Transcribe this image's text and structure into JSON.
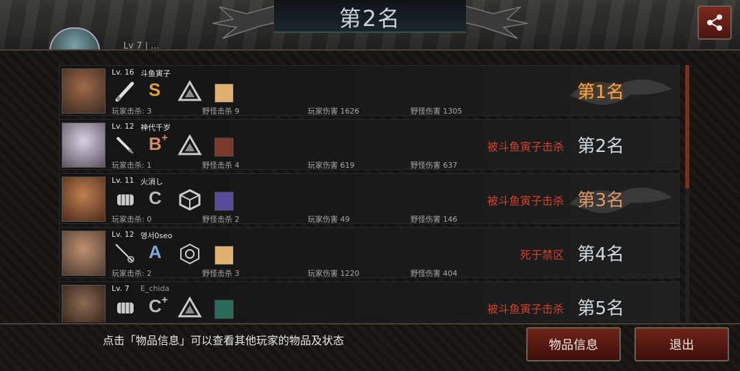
{
  "header": {
    "title": "第2名",
    "partial_label": "Lv 7 | ..."
  },
  "players": [
    {
      "level": "Lv. 16",
      "name": "斗鱼寅子",
      "weapon": "bat-icon",
      "grade": "S",
      "grade_plus": "",
      "grade_color": "#e0a040",
      "trait": "triangle-trait-icon",
      "player_kills": "玩家击杀: 3",
      "monster_kills": "野怪击杀 9",
      "player_damage": "玩家伤害 1626",
      "monster_damage": "野怪伤害 1305",
      "death": "",
      "rank": "第1名"
    },
    {
      "level": "Lv. 12",
      "name": "神代千岁",
      "weapon": "dagger-icon",
      "grade": "B",
      "grade_plus": "+",
      "grade_color": "#d48a6a",
      "trait": "triangle-trait-icon",
      "player_kills": "玩家击杀: 1",
      "monster_kills": "野怪击杀 4",
      "player_damage": "玩家伤害 619",
      "monster_damage": "野怪伤害 637",
      "death": "被斗鱼寅子击杀",
      "rank": "第2名"
    },
    {
      "level": "Lv. 11",
      "name": "火消し",
      "weapon": "fist-icon",
      "grade": "C",
      "grade_plus": "",
      "grade_color": "#b8b8b8",
      "trait": "cube-trait-icon",
      "player_kills": "玩家击杀: 0",
      "monster_kills": "野怪击杀 2",
      "player_damage": "玩家伤害 49",
      "monster_damage": "野怪伤害 146",
      "death": "被斗鱼寅子击杀",
      "rank": "第3名"
    },
    {
      "level": "Lv. 12",
      "name": "영서0seo",
      "weapon": "rapier-icon",
      "grade": "A",
      "grade_plus": "",
      "grade_color": "#7fa8d8",
      "trait": "hexagon-trait-icon",
      "player_kills": "玩家击杀: 2",
      "monster_kills": "野怪击杀 3",
      "player_damage": "玩家伤害 1220",
      "monster_damage": "野怪伤害 404",
      "death": "死于禁区",
      "rank": "第4名"
    },
    {
      "level": "Lv. 7",
      "name": "E_chida",
      "weapon": "fist-icon",
      "grade": "C",
      "grade_plus": "+",
      "grade_color": "#b8b8b8",
      "trait": "triangle-trait-icon",
      "player_kills": "",
      "monster_kills": "",
      "player_damage": "",
      "monster_damage": "",
      "death": "被斗鱼寅子击杀",
      "rank": "第5名"
    }
  ],
  "footer": {
    "hint": "点击「物品信息」可以查看其他玩家的物品及状态",
    "info_button": "物品信息",
    "exit_button": "退出"
  }
}
